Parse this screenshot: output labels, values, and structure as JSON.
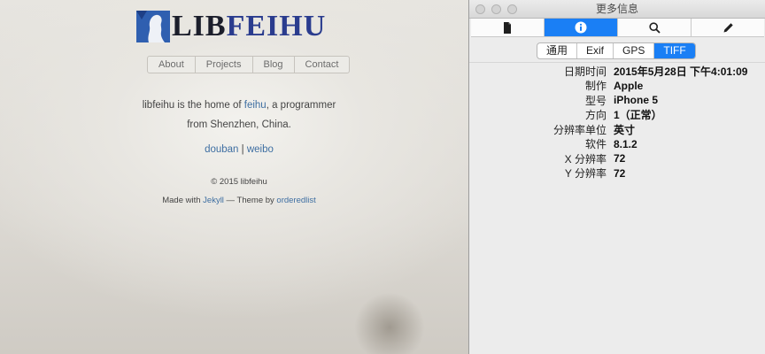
{
  "photo": {
    "logo": {
      "lib": "LIB",
      "feihu": "FEIHU"
    },
    "nav": [
      "About",
      "Projects",
      "Blog",
      "Contact"
    ],
    "intro": {
      "before": "libfeihu is the home of ",
      "link": "feihu",
      "after": ", a programmer",
      "line2": "from Shenzhen, China."
    },
    "social": {
      "douban": "douban",
      "sep": " | ",
      "weibo": "weibo"
    },
    "copyright": "© 2015 libfeihu",
    "made": {
      "prefix": "Made with ",
      "jekyll": "Jekyll",
      "mid": " — Theme by ",
      "theme": "orderedlist"
    }
  },
  "window": {
    "title": "更多信息",
    "toolbar": [
      "document-icon",
      "info-icon",
      "search-icon",
      "pencil-icon"
    ],
    "active_tool": "info-icon",
    "tabs": [
      "通用",
      "Exif",
      "GPS",
      "TIFF"
    ],
    "active_tab": "TIFF",
    "properties": [
      {
        "label": "日期时间",
        "value": "2015年5月28日 下午4:01:09"
      },
      {
        "label": "制作",
        "value": "Apple"
      },
      {
        "label": "型号",
        "value": "iPhone 5"
      },
      {
        "label": "方向",
        "value": "1（正常）"
      },
      {
        "label": "分辨率单位",
        "value": "英寸"
      },
      {
        "label": "软件",
        "value": "8.1.2"
      },
      {
        "label": "X 分辨率",
        "value": "72"
      },
      {
        "label": "Y 分辨率",
        "value": "72"
      }
    ],
    "accent": "#1a7ff5"
  }
}
